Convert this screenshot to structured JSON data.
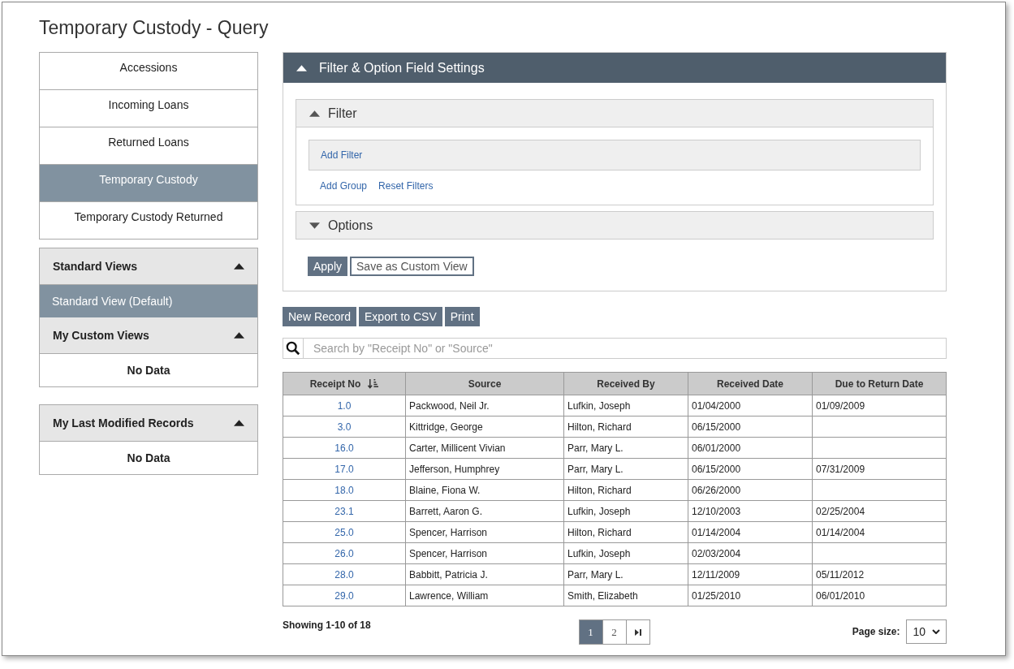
{
  "page_title": "Temporary Custody - Query",
  "nav": [
    {
      "label": "Accessions",
      "selected": false
    },
    {
      "label": "Incoming Loans",
      "selected": false
    },
    {
      "label": "Returned Loans",
      "selected": false
    },
    {
      "label": "Temporary Custody",
      "selected": true
    },
    {
      "label": "Temporary Custody Returned",
      "selected": false
    }
  ],
  "views_panel": {
    "sections": [
      {
        "title": "Standard Views",
        "expanded": true,
        "items": [
          {
            "label": "Standard View (Default)",
            "selected": true
          }
        ]
      },
      {
        "title": "My Custom Views",
        "expanded": true,
        "empty_text": "No Data"
      }
    ]
  },
  "last_modified": {
    "title": "My Last Modified Records",
    "expanded": true,
    "empty_text": "No Data"
  },
  "settings": {
    "title": "Filter & Option Field Settings",
    "expanded": true,
    "filter": {
      "title": "Filter",
      "expanded": true,
      "add_filter": "Add Filter",
      "links": [
        "Add Group",
        "Reset Filters"
      ]
    },
    "options": {
      "title": "Options",
      "expanded": false
    },
    "apply": "Apply",
    "save_view": "Save as Custom View"
  },
  "toolbar": [
    "New Record",
    "Export to CSV",
    "Print"
  ],
  "search": {
    "placeholder": "Search by \"Receipt No\" or \"Source\""
  },
  "table": {
    "columns": [
      {
        "label": "Receipt No",
        "sorted": true
      },
      {
        "label": "Source",
        "sorted": false
      },
      {
        "label": "Received By",
        "sorted": false
      },
      {
        "label": "Received Date",
        "sorted": false
      },
      {
        "label": "Due to Return Date",
        "sorted": false
      }
    ],
    "rows": [
      [
        "1.0",
        "Packwood, Neil Jr.",
        "Lufkin, Joseph",
        "01/04/2000",
        "01/09/2009"
      ],
      [
        "3.0",
        "Kittridge, George",
        "Hilton, Richard",
        "06/15/2000",
        ""
      ],
      [
        "16.0",
        "Carter, Millicent Vivian",
        "Parr, Mary L.",
        "06/01/2000",
        ""
      ],
      [
        "17.0",
        "Jefferson, Humphrey",
        "Parr, Mary L.",
        "06/15/2000",
        "07/31/2009"
      ],
      [
        "18.0",
        "Blaine, Fiona W.",
        "Hilton, Richard",
        "06/26/2000",
        ""
      ],
      [
        "23.1",
        "Barrett, Aaron G.",
        "Lufkin, Joseph",
        "12/10/2003",
        "02/25/2004"
      ],
      [
        "25.0",
        "Spencer, Harrison",
        "Hilton, Richard",
        "01/14/2004",
        "01/14/2004"
      ],
      [
        "26.0",
        "Spencer, Harrison",
        "Lufkin, Joseph",
        "02/03/2004",
        ""
      ],
      [
        "28.0",
        "Babbitt, Patricia J.",
        "Parr, Mary L.",
        "12/11/2009",
        "05/11/2012"
      ],
      [
        "29.0",
        "Lawrence, William",
        "Smith, Elizabeth",
        "01/25/2010",
        "06/01/2010"
      ]
    ]
  },
  "summary": "Showing 1-10 of 18",
  "pager": {
    "pages": [
      {
        "label": "1",
        "selected": true
      },
      {
        "label": "2",
        "selected": false
      }
    ]
  },
  "page_size": {
    "label": "Page size:",
    "value": "10"
  }
}
